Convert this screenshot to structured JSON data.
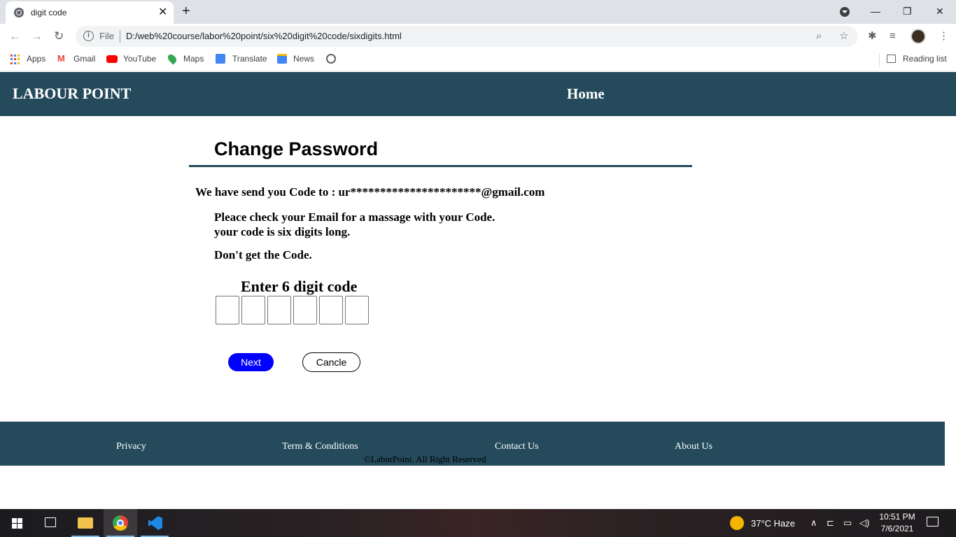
{
  "browser": {
    "tab_title": "digit code",
    "tab_close": "✕",
    "new_tab": "+",
    "window_controls": {
      "minimize": "—",
      "restore": "❐",
      "close": "✕"
    },
    "nav": {
      "back": "←",
      "forward": "→",
      "reload": "↻"
    },
    "address": {
      "scheme_label": "File",
      "url": "D:/web%20course/labor%20point/six%20digit%20code/sixdigits.html"
    },
    "toolbar_icons": [
      "zoom-icon",
      "star-icon",
      "extensions-icon",
      "reading-list-icon",
      "menu-icon"
    ],
    "bookmarks": [
      {
        "label": "Apps",
        "icon": "apps-grid-icon"
      },
      {
        "label": "Gmail",
        "icon": "gmail-icon"
      },
      {
        "label": "YouTube",
        "icon": "youtube-icon"
      },
      {
        "label": "Maps",
        "icon": "maps-icon"
      },
      {
        "label": "Translate",
        "icon": "translate-icon"
      },
      {
        "label": "News",
        "icon": "news-icon"
      }
    ],
    "reading_list": "Reading list"
  },
  "site": {
    "brand": "LABOUR POINT",
    "nav_home": "Home",
    "colors": {
      "header": "#244a5c",
      "next_button": "#0000ff"
    }
  },
  "main": {
    "heading": "Change Password",
    "sent_to": "We have send you Code to : ur**********************@gmail.com",
    "check_email": "Pleace check your Email for a massage with your Code.",
    "code_length": "your code is six digits long.",
    "resend": "Don't get the Code.",
    "code_title": "Enter 6 digit code",
    "digits": [
      "",
      "",
      "",
      "",
      "",
      ""
    ],
    "next_label": "Next",
    "cancel_label": "Cancle"
  },
  "footer": {
    "links": [
      "Privacy",
      "Term & Conditions",
      "Contact Us",
      "About Us"
    ],
    "copyright": "©LaborPoint. All Right Reserved"
  },
  "taskbar": {
    "weather": "37°C  Haze",
    "time": "10:51 PM",
    "date": "7/6/2021"
  }
}
